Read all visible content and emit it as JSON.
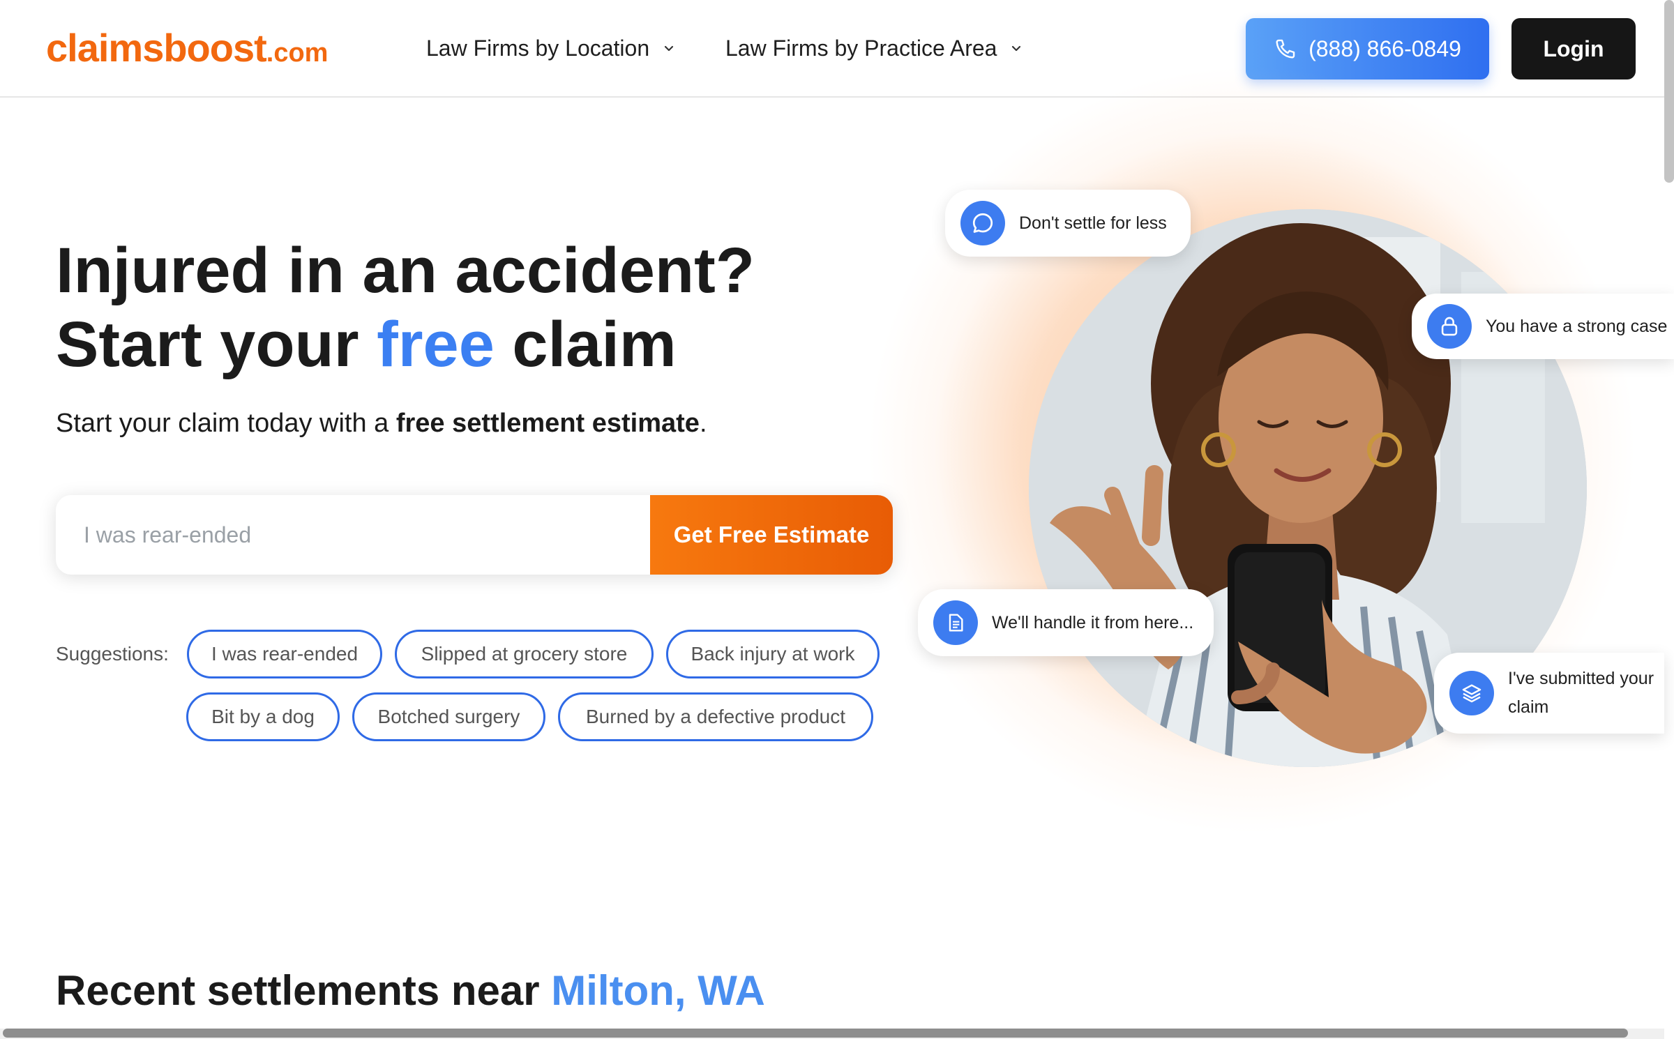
{
  "header": {
    "logo_main": "claimsboost",
    "logo_tld": ".com",
    "nav": [
      {
        "label": "Law Firms by Location",
        "icon": "chevron-down-icon"
      },
      {
        "label": "Law Firms by Practice Area",
        "icon": "chevron-down-icon"
      }
    ],
    "phone": "(888) 866-0849",
    "phone_icon": "phone-icon",
    "login": "Login"
  },
  "hero": {
    "headline_line1": "Injured in an accident?",
    "headline_line2_pre": "Start your ",
    "headline_line2_accent": "free",
    "headline_line2_post": " claim",
    "subhead_pre": "Start your claim today with a ",
    "subhead_bold": "free settlement estimate",
    "subhead_post": ".",
    "search_placeholder": "I was rear-ended",
    "cta": "Get Free Estimate",
    "suggestions_label": "Suggestions:",
    "suggestions": [
      "I was rear-ended",
      "Slipped at grocery store",
      "Back injury at work",
      "Bit by a dog",
      "Botched surgery",
      "Burned by a defective product"
    ]
  },
  "bubbles": [
    {
      "text": "Don't settle for less",
      "icon": "chat-icon"
    },
    {
      "text": "You have a strong case",
      "icon": "lock-icon"
    },
    {
      "text": "We'll handle it from here...",
      "icon": "document-icon"
    },
    {
      "text": "I've submitted your claim",
      "icon": "layers-icon"
    }
  ],
  "recent": {
    "prefix": "Recent settlements near ",
    "location": "Milton, WA"
  },
  "colors": {
    "brand_orange": "#f2680f",
    "accent_blue": "#3b7ff2",
    "chip_border": "#2f6ae6",
    "login_bg": "#161616"
  }
}
